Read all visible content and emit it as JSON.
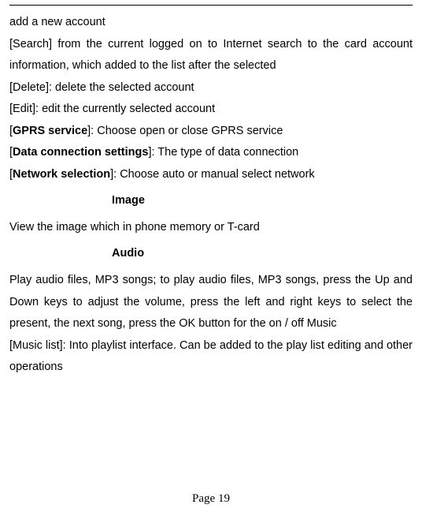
{
  "body": {
    "line1": "add a new account",
    "line2": "[Search] from the current logged on to Internet search to the card account information, which added to the list after the selected",
    "line3": "[Delete]: delete the selected account",
    "line4": "[Edit]: edit the currently selected account",
    "line5_pre": "[",
    "line5_bold": "GPRS service",
    "line5_post": "]: Choose open or close GPRS service",
    "line6_pre": "[",
    "line6_bold": "Data connection settings",
    "line6_post": "]: The type of data connection",
    "line7_pre": "[",
    "line7_bold": "Network selection",
    "line7_post": "]: Choose auto or manual select network",
    "heading_image": "Image",
    "image_para": "View the image which in phone memory or T-card",
    "heading_audio": "Audio",
    "audio_para1": "Play audio files, MP3 songs; to play audio files, MP3 songs, press the Up and Down keys to adjust the volume, press the left and right keys to select the present, the next song, press the OK button for the on / off Music",
    "audio_para2": "[Music list]: Into playlist interface. Can be added to the play list editing and other operations"
  },
  "footer": {
    "page_label": "Page 19"
  }
}
